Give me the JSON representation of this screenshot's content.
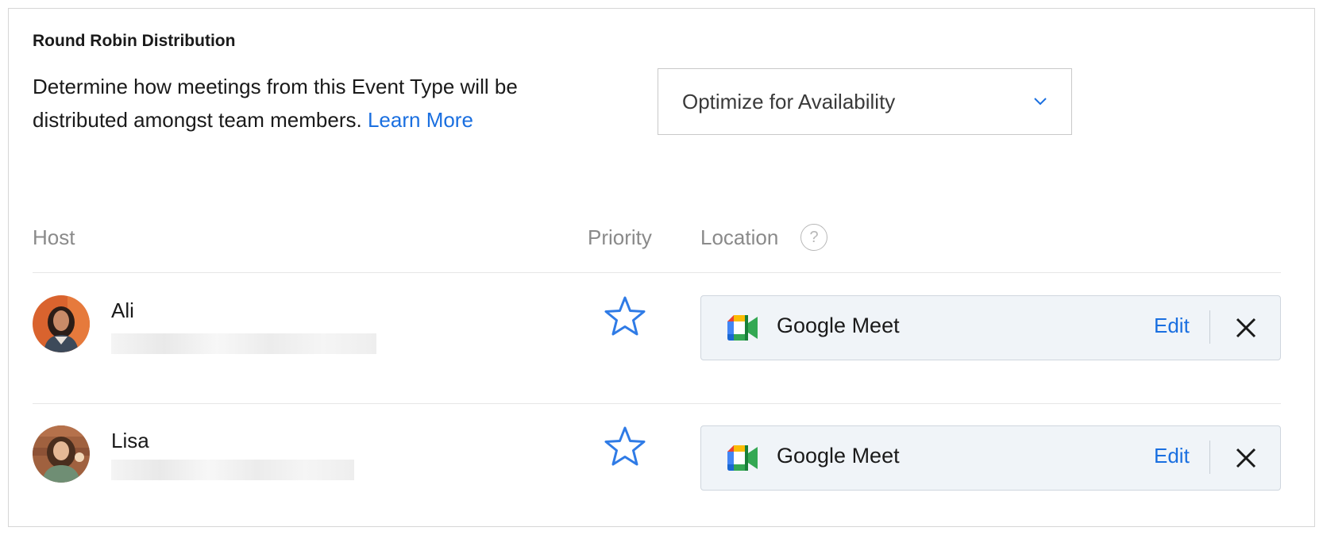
{
  "section": {
    "title": "Round Robin Distribution",
    "description": "Determine how meetings from this Event Type will be distributed amongst team members.",
    "learn_more": "Learn More"
  },
  "distribution_select": {
    "value": "Optimize for Availability",
    "icon": "chevron-down-icon"
  },
  "table": {
    "headers": {
      "host": "Host",
      "priority": "Priority",
      "location": "Location",
      "help": "?"
    },
    "rows": [
      {
        "name": "Ali",
        "priority_icon": "star-outline-icon",
        "location": "Google Meet",
        "edit_label": "Edit",
        "location_icon": "google-meet-icon"
      },
      {
        "name": "Lisa",
        "priority_icon": "star-outline-icon",
        "location": "Google Meet",
        "edit_label": "Edit",
        "location_icon": "google-meet-icon"
      }
    ]
  },
  "colors": {
    "link": "#1a6fe0",
    "star": "#2f7be6",
    "location_bg": "#f0f4f8"
  }
}
